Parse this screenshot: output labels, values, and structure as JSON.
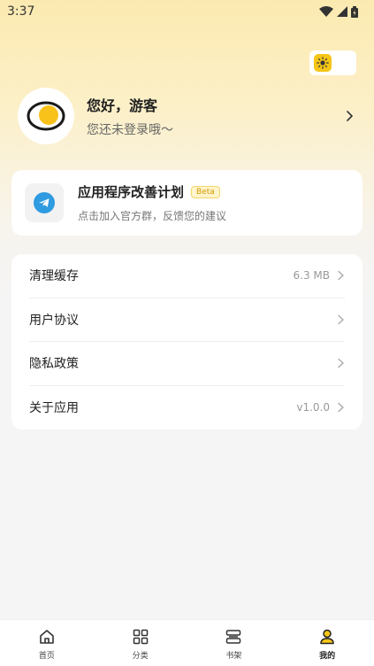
{
  "status_bar": {
    "time": "3:37"
  },
  "profile": {
    "greeting": "您好，游客",
    "login_hint": "您还未登录哦～"
  },
  "feedback": {
    "title": "应用程序改善计划",
    "badge": "Beta",
    "subtitle": "点击加入官方群，反馈您的建议"
  },
  "settings": {
    "items": [
      {
        "label": "清理缓存",
        "value": "6.3 MB"
      },
      {
        "label": "用户协议",
        "value": ""
      },
      {
        "label": "隐私政策",
        "value": ""
      },
      {
        "label": "关于应用",
        "value": "v1.0.0"
      }
    ]
  },
  "nav": {
    "items": [
      {
        "label": "首页",
        "icon": "home-icon"
      },
      {
        "label": "分类",
        "icon": "category-icon"
      },
      {
        "label": "书架",
        "icon": "bookshelf-icon"
      },
      {
        "label": "我的",
        "icon": "profile-icon"
      }
    ],
    "active_index": 3
  },
  "colors": {
    "accent": "#f5c518",
    "telegram": "#2f9be0",
    "background": "#f5f5f5"
  }
}
